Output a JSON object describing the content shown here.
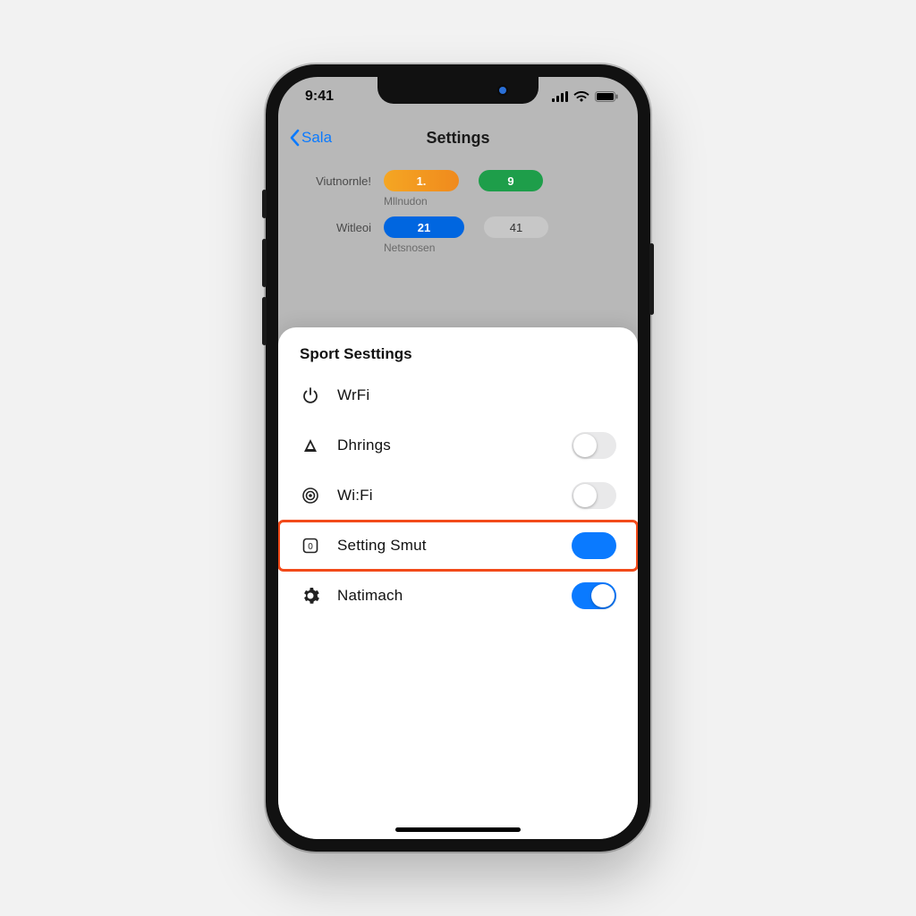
{
  "status": {
    "time": "9:41"
  },
  "nav": {
    "back_label": "Sala",
    "title": "Settings"
  },
  "stats": {
    "row1_label": "Viutnornle!",
    "row1_val1": "1.",
    "row1_val2": "9",
    "row1_sub": "Mllnudon",
    "row2_label": "Witleoi",
    "row2_val1": "21",
    "row2_val2": "41",
    "row2_sub": "Netsnosen"
  },
  "sheet": {
    "title": "Sport Sesttings",
    "items": [
      {
        "label": "WrFi"
      },
      {
        "label": "Dhrings"
      },
      {
        "label": "Wi:Fi"
      },
      {
        "label": "Setting Smut"
      },
      {
        "label": "Natimach"
      }
    ]
  }
}
